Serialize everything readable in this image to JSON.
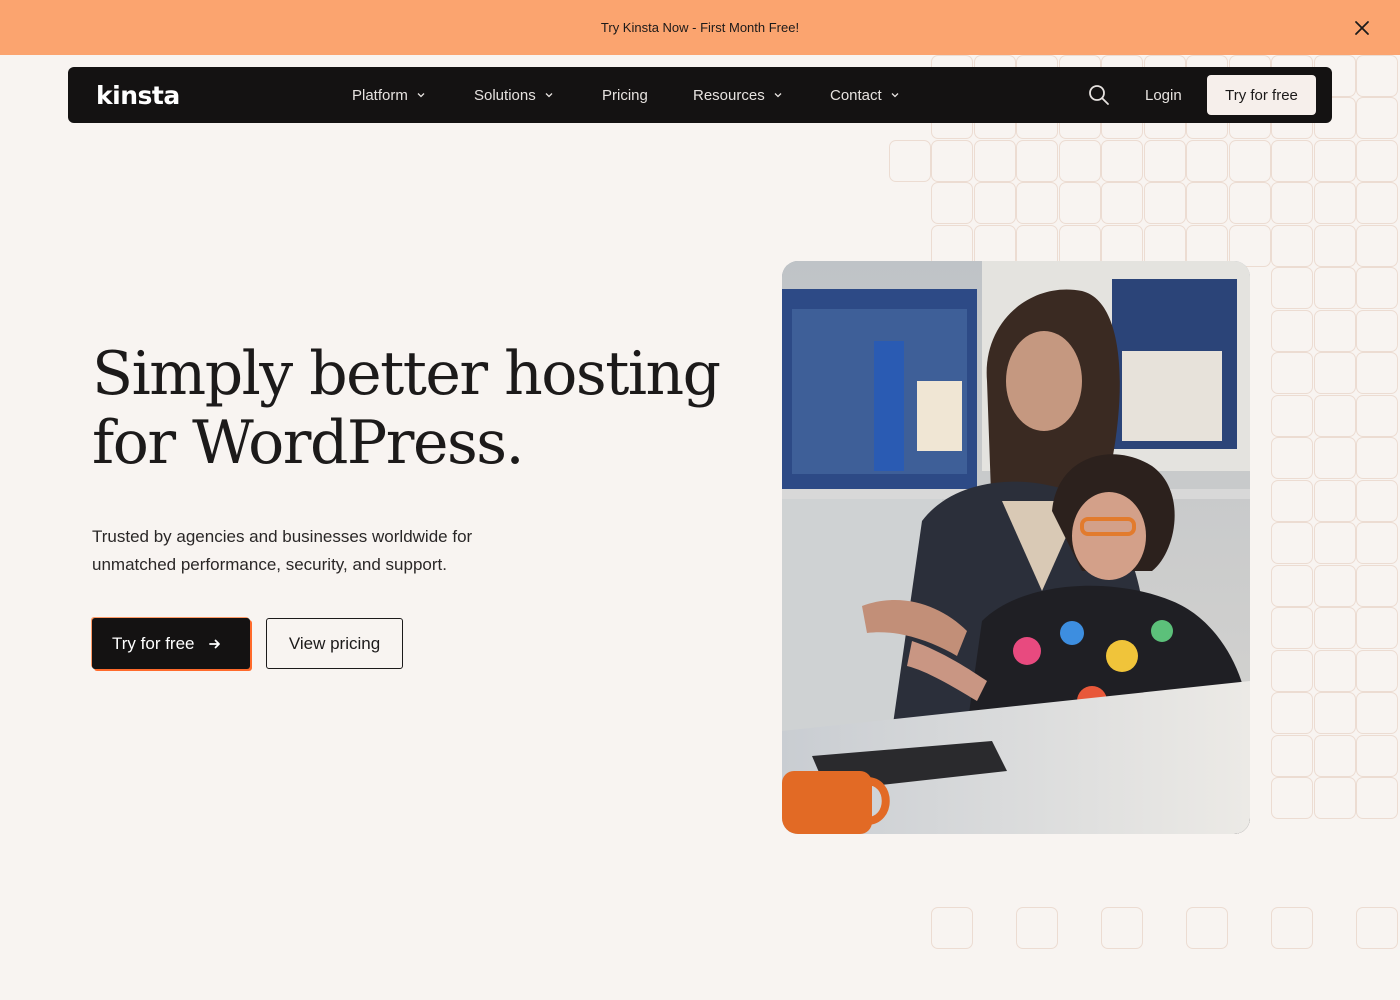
{
  "announcement": {
    "text": "Try Kinsta Now - First Month Free!",
    "close_icon": "close-icon",
    "background": "#fba46f"
  },
  "nav": {
    "logo_text": "kinsta",
    "items": [
      {
        "label": "Platform",
        "has_dropdown": true
      },
      {
        "label": "Solutions",
        "has_dropdown": true
      },
      {
        "label": "Pricing",
        "has_dropdown": false
      },
      {
        "label": "Resources",
        "has_dropdown": true
      },
      {
        "label": "Contact",
        "has_dropdown": true
      }
    ],
    "search_icon": "search-icon",
    "login_label": "Login",
    "cta_label": "Try for free",
    "background": "#141212"
  },
  "hero": {
    "title_line1": "Simply better hosting",
    "title_line2": "for WordPress.",
    "subtitle": "Trusted by agencies and businesses worldwide for unmatched performance, security, and support.",
    "primary_cta": "Try for free",
    "primary_cta_icon": "arrow-right-icon",
    "secondary_cta": "View pricing",
    "accent": "#ff6a2b",
    "image": "photo of two women smiling at a computer screen in an office"
  }
}
